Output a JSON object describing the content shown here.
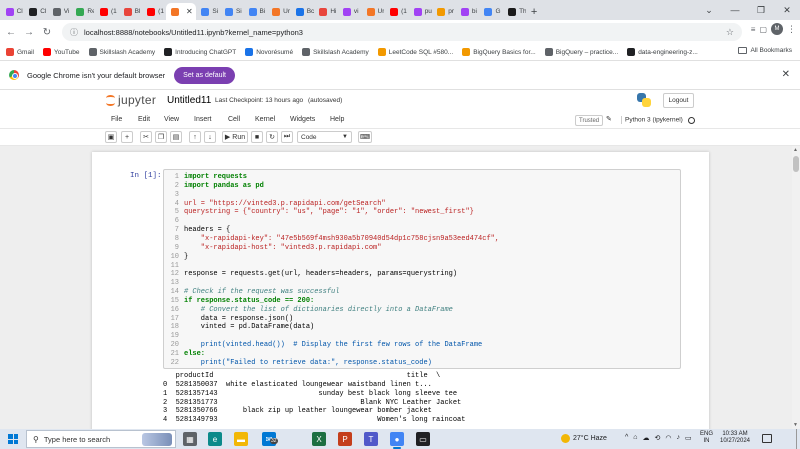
{
  "browser": {
    "tabs": [
      {
        "label": "Cl",
        "color": "#a142f4"
      },
      {
        "label": "Cl",
        "color": "#202124"
      },
      {
        "label": "Vi",
        "color": "#5f6368"
      },
      {
        "label": "Re",
        "color": "#34a853"
      },
      {
        "label": "(1",
        "color": "#ff0000"
      },
      {
        "label": "Bl",
        "color": "#e8453c"
      },
      {
        "label": "(1",
        "color": "#ff0000"
      },
      {
        "label": "",
        "color": "#f37626",
        "active": true
      },
      {
        "label": "Si",
        "color": "#4285f4"
      },
      {
        "label": "Si",
        "color": "#4285f4"
      },
      {
        "label": "Bi",
        "color": "#4285f4"
      },
      {
        "label": "Ur",
        "color": "#f37626"
      },
      {
        "label": "Bc",
        "color": "#1a73e8"
      },
      {
        "label": "Hi",
        "color": "#e8453c"
      },
      {
        "label": "vi",
        "color": "#a142f4"
      },
      {
        "label": "Ur",
        "color": "#f37626"
      },
      {
        "label": "(1",
        "color": "#ff0000"
      },
      {
        "label": "pu",
        "color": "#a142f4"
      },
      {
        "label": "pr",
        "color": "#f29900"
      },
      {
        "label": "bi",
        "color": "#a142f4"
      },
      {
        "label": "G",
        "color": "#4285f4"
      },
      {
        "label": "Th",
        "color": "#1a1a1a"
      }
    ],
    "new_tab": "+",
    "url": "localhost:8888/notebooks/Untitled11.ipynb?kernel_name=python3",
    "profile_initial": "M",
    "bookmarks": [
      {
        "label": "Gmail",
        "color": "#ea4335"
      },
      {
        "label": "YouTube",
        "color": "#ff0000"
      },
      {
        "label": "Skillslash Academy",
        "color": "#5f6368"
      },
      {
        "label": "Introducing ChatGPT",
        "color": "#202124"
      },
      {
        "label": "Novorésumé",
        "color": "#1a73e8"
      },
      {
        "label": "Skillslash Academy",
        "color": "#5f6368"
      },
      {
        "label": "LeetCode SQL #580...",
        "color": "#f29900"
      },
      {
        "label": "BigQuery Basics for...",
        "color": "#f29900"
      },
      {
        "label": "BigQuery – practice...",
        "color": "#5f6368"
      },
      {
        "label": "data-engineering-z...",
        "color": "#202124"
      }
    ],
    "all_bookmarks": "All Bookmarks",
    "infobar_text": "Google Chrome isn't your default browser",
    "infobar_button": "Set as default"
  },
  "jupyter": {
    "logo_text": "jupyter",
    "notebook_name": "Untitled11",
    "checkpoint": "Last Checkpoint: 13 hours ago",
    "autosave": "(autosaved)",
    "logout": "Logout",
    "menu": [
      "File",
      "Edit",
      "View",
      "Insert",
      "Cell",
      "Kernel",
      "Widgets",
      "Help"
    ],
    "trusted": "Trusted",
    "kernel": "Python 3 (ipykernel)",
    "toolbar": {
      "run": "Run",
      "cell_type": "Code"
    }
  },
  "cell": {
    "prompt": "In [1]:",
    "lines": [
      {
        "n": "1",
        "text": "import requests",
        "cls": "kw"
      },
      {
        "n": "2",
        "text": "import pandas as pd",
        "cls": "kw"
      },
      {
        "n": "3",
        "text": "",
        "cls": ""
      },
      {
        "n": "4",
        "text": "url = \"https://vinted3.p.rapidapi.com/getSearch\"",
        "cls": "str"
      },
      {
        "n": "5",
        "text": "querystring = {\"country\": \"us\", \"page\": \"1\", \"order\": \"newest_first\"}",
        "cls": "str"
      },
      {
        "n": "6",
        "text": "",
        "cls": ""
      },
      {
        "n": "7",
        "text": "headers = {",
        "cls": ""
      },
      {
        "n": "8",
        "text": "    \"x-rapidapi-key\": \"47e5b569f4msh930a5b70940d54dp1c758cjsn9a53eed474cf\",",
        "cls": "str"
      },
      {
        "n": "9",
        "text": "    \"x-rapidapi-host\": \"vinted3.p.rapidapi.com\"",
        "cls": "str"
      },
      {
        "n": "10",
        "text": "}",
        "cls": ""
      },
      {
        "n": "11",
        "text": "",
        "cls": ""
      },
      {
        "n": "12",
        "text": "response = requests.get(url, headers=headers, params=querystring)",
        "cls": ""
      },
      {
        "n": "13",
        "text": "",
        "cls": ""
      },
      {
        "n": "14",
        "text": "# Check if the request was successful",
        "cls": "cm"
      },
      {
        "n": "15",
        "text": "if response.status_code == 200:",
        "cls": "kw"
      },
      {
        "n": "16",
        "text": "    # Convert the list of dictionaries directly into a DataFrame",
        "cls": "cm"
      },
      {
        "n": "17",
        "text": "    data = response.json()",
        "cls": ""
      },
      {
        "n": "18",
        "text": "    vinted = pd.DataFrame(data)",
        "cls": ""
      },
      {
        "n": "19",
        "text": "",
        "cls": ""
      },
      {
        "n": "20",
        "text": "    print(vinted.head())  # Display the first few rows of the DataFrame",
        "cls": "blue"
      },
      {
        "n": "21",
        "text": "else:",
        "cls": "kw"
      },
      {
        "n": "22",
        "text": "    print(\"Failed to retrieve data:\", response.status_code)",
        "cls": "blue"
      }
    ]
  },
  "output": {
    "header": "   productId                                              title  \\",
    "rows": [
      "0  5281350037  white elasticated loungewear waistband linen t...",
      "1  5281357143                        sunday best black long sleeve tee",
      "2  5281351773                                  Blank NYC Leather Jacket",
      "3  5281350766      black zip up leather loungewear bomber jacket",
      "4  5281349793                                      Women's long raincoat"
    ]
  },
  "taskbar": {
    "search_placeholder": "Type here to search",
    "apps": [
      {
        "name": "task-view-icon",
        "color": "#5f6368",
        "glyph": "▦"
      },
      {
        "name": "edge-icon",
        "color": "#0c8a8a",
        "glyph": "e"
      },
      {
        "name": "file-explorer-icon",
        "color": "#f2b705",
        "glyph": "▬"
      },
      {
        "name": "mail-icon",
        "color": "#0078d4",
        "glyph": "✉"
      },
      {
        "name": "excel-icon",
        "color": "#1d6f42",
        "glyph": "X"
      },
      {
        "name": "powerpoint-icon",
        "color": "#c43e1c",
        "glyph": "P"
      },
      {
        "name": "teams-icon",
        "color": "#5059c9",
        "glyph": "T"
      },
      {
        "name": "chrome-icon",
        "color": "#4285f4",
        "glyph": "●",
        "active": true
      },
      {
        "name": "terminal-icon",
        "color": "#202124",
        "glyph": "▭"
      }
    ],
    "mail_badge": "32",
    "weather": "27°C  Haze",
    "lang_top": "ENG",
    "lang_bottom": "IN",
    "time": "10:33 AM",
    "date": "10/27/2024"
  }
}
